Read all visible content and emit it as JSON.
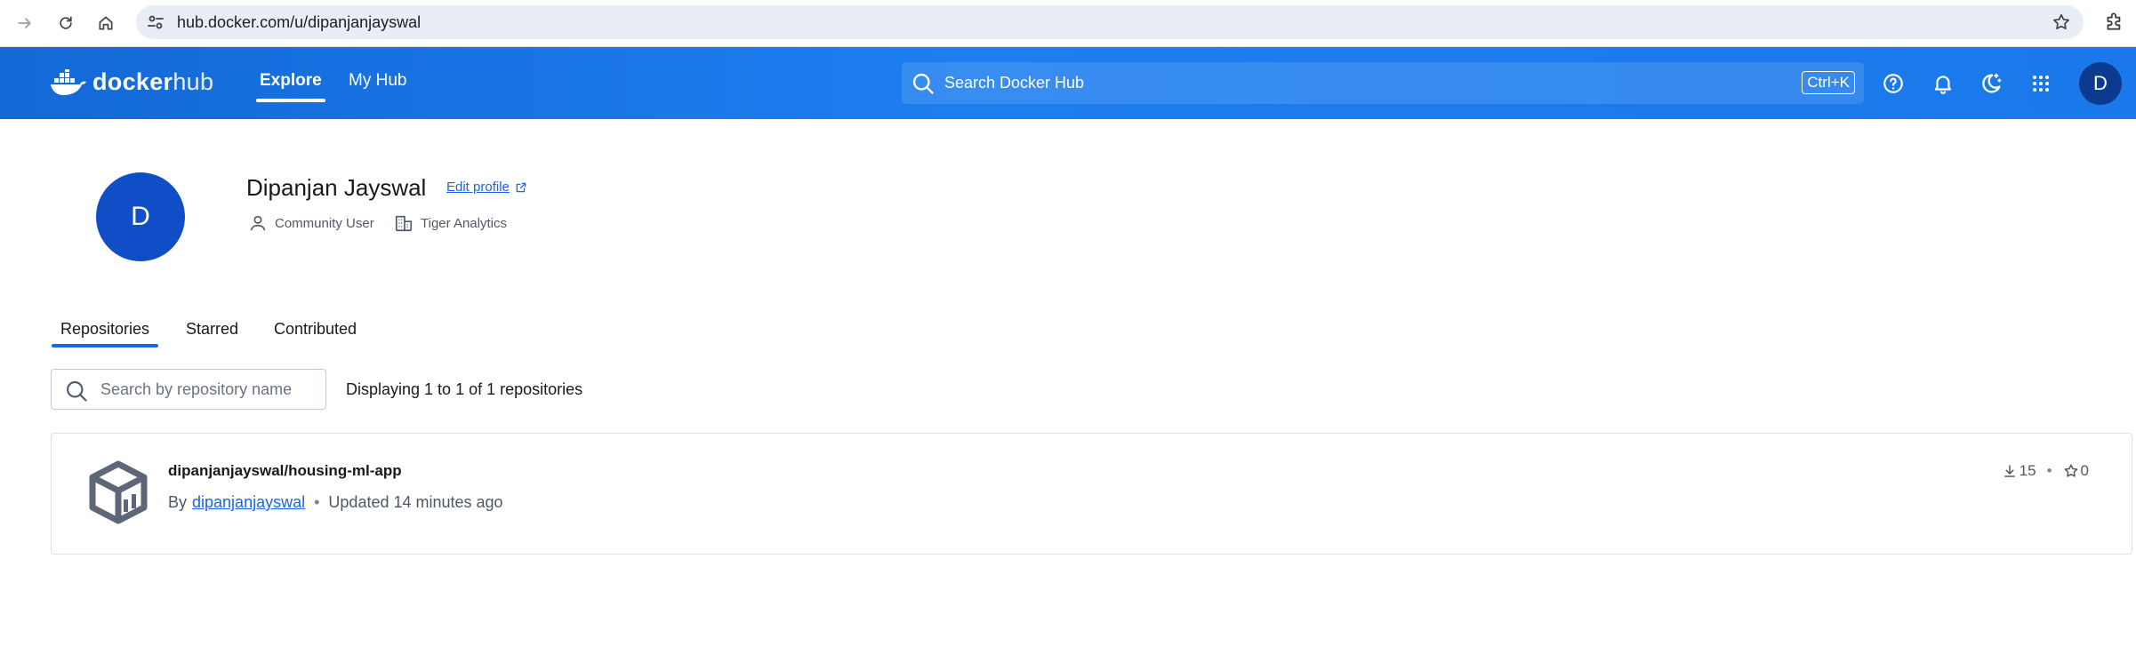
{
  "browser": {
    "url": "hub.docker.com/u/dipanjanjayswal"
  },
  "header": {
    "logo": {
      "brand_bold": "docker",
      "brand_light": "hub"
    },
    "nav": [
      {
        "label": "Explore",
        "active": true
      },
      {
        "label": "My Hub",
        "active": false
      }
    ],
    "search": {
      "placeholder": "Search Docker Hub",
      "shortcut": "Ctrl+K"
    },
    "icons": [
      "help-icon",
      "bell-icon",
      "theme-icon",
      "apps-grid-icon"
    ],
    "avatar_initial": "D"
  },
  "profile": {
    "avatar_initial": "D",
    "name": "Dipanjan Jayswal",
    "edit_label": "Edit profile",
    "role": "Community User",
    "company": "Tiger Analytics"
  },
  "tabs": [
    {
      "label": "Repositories",
      "active": true
    },
    {
      "label": "Starred",
      "active": false
    },
    {
      "label": "Contributed",
      "active": false
    }
  ],
  "repos_search": {
    "placeholder": "Search by repository name",
    "count_text": "Displaying 1 to 1 of 1 repositories"
  },
  "repositories": [
    {
      "name": "dipanjanjayswal/housing-ml-app",
      "by_label": "By",
      "owner": "dipanjanjayswal",
      "updated": "Updated 14 minutes ago",
      "downloads": "15",
      "stars": "0"
    }
  ],
  "colors": {
    "header_blue": "#1d7ef0",
    "accent": "#1d63ed",
    "avatar": "#0f4ec7"
  }
}
